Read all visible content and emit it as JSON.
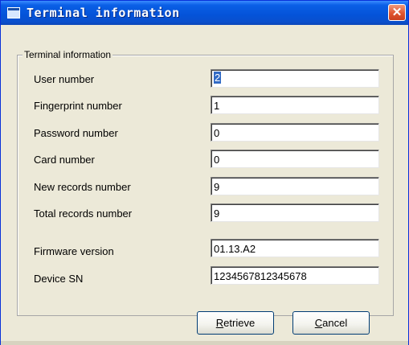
{
  "window": {
    "title": "Terminal information",
    "close_glyph": "✕"
  },
  "group": {
    "label": "Terminal information",
    "fields": [
      {
        "label": "User number",
        "value": "2"
      },
      {
        "label": "Fingerprint number",
        "value": "1"
      },
      {
        "label": "Password number",
        "value": "0"
      },
      {
        "label": "Card number",
        "value": "0"
      },
      {
        "label": "New records number",
        "value": "9"
      },
      {
        "label": "Total records number",
        "value": "9"
      },
      {
        "label": "Firmware version",
        "value": "01.13.A2"
      },
      {
        "label": "Device SN",
        "value": "1234567812345678"
      }
    ]
  },
  "buttons": {
    "retrieve": {
      "accel": "R",
      "rest": "etrieve"
    },
    "cancel": {
      "accel": "C",
      "rest": "ancel"
    }
  },
  "colors": {
    "title_bar": "#0453d8",
    "dialog_face": "#ece9d8",
    "close_button": "#e0552f",
    "selection": "#316ac5"
  },
  "icons": {
    "app": "app-window-icon",
    "close": "close-icon"
  }
}
